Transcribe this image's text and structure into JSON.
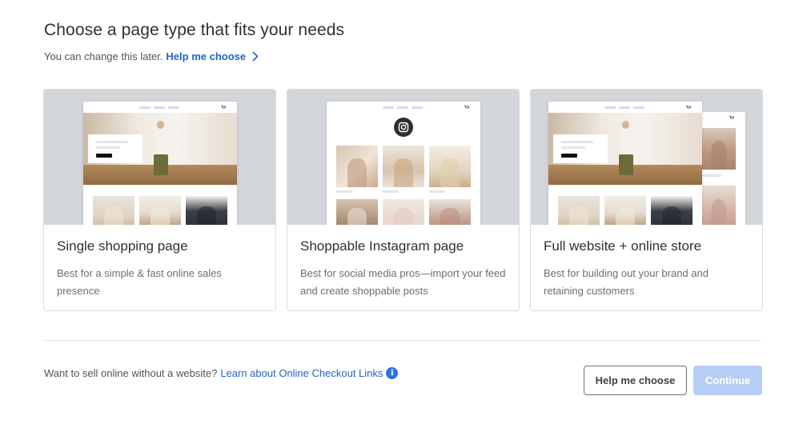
{
  "header": {
    "title": "Choose a page type that fits your needs",
    "subtitle": "You can change this later.",
    "help_link": "Help me choose",
    "help_link_icon": "chevron-right-icon"
  },
  "cards": [
    {
      "title": "Single shopping page",
      "description": "Best for a simple & fast online sales presence",
      "image": "single-shopping-page-preview"
    },
    {
      "title": "Shoppable Instagram page",
      "description": "Best for social media pros—import your feed and create shoppable posts",
      "image": "instagram-page-preview",
      "badge_icon": "instagram-icon"
    },
    {
      "title": "Full website + online store",
      "description": "Best for building out your brand and retaining customers",
      "image": "full-website-preview"
    }
  ],
  "footer": {
    "question": "Want to sell online without a website?",
    "link": "Learn about Online Checkout Links",
    "info_icon": "info-icon",
    "secondary_button": "Help me choose",
    "primary_button": "Continue"
  },
  "colors": {
    "link": "#2463c9",
    "primary_button_disabled": "#b7cdf6",
    "card_image_bg": "#d2d6da",
    "info_icon": "#2f6ee6"
  }
}
